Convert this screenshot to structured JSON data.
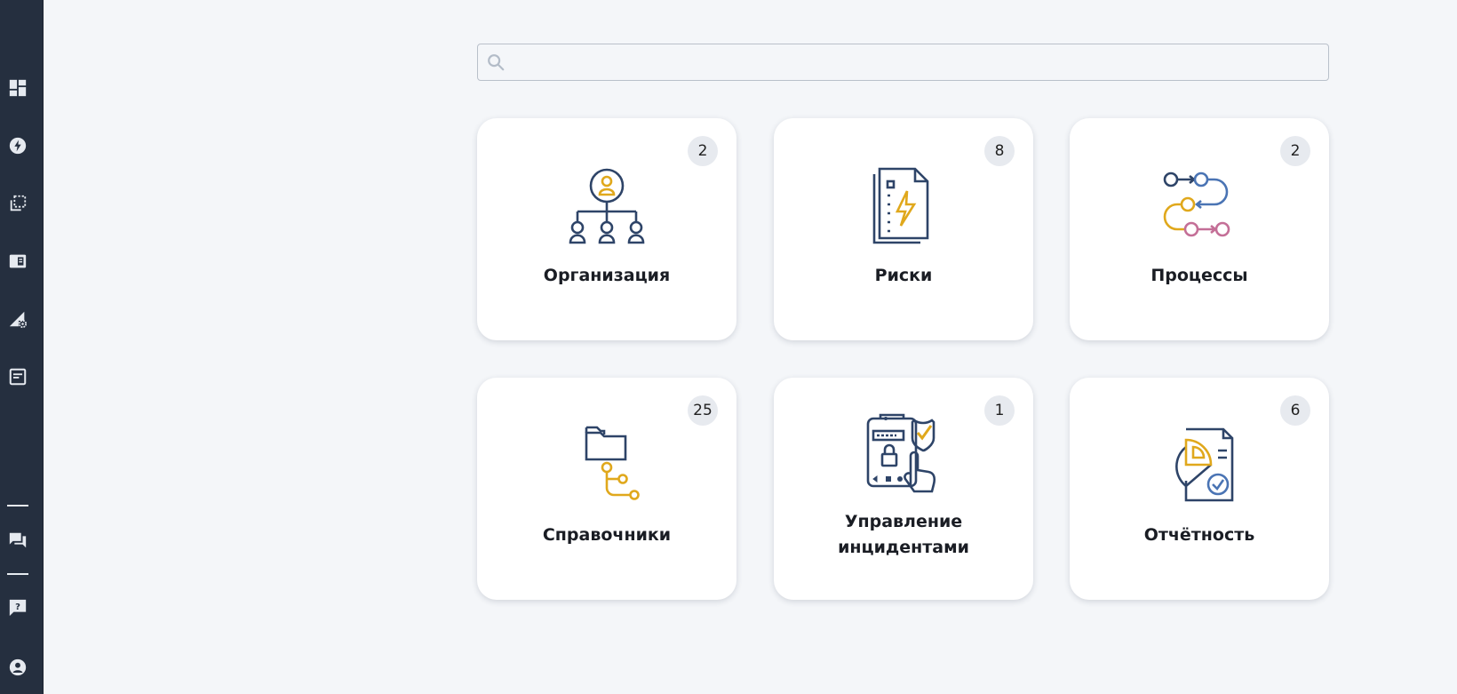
{
  "sidebar": {
    "top_items": [
      {
        "icon": "dashboard-icon"
      },
      {
        "icon": "lightning-icon"
      },
      {
        "icon": "copy-icon"
      },
      {
        "icon": "book-icon"
      },
      {
        "icon": "triangle-gear-icon"
      },
      {
        "icon": "document-icon"
      }
    ],
    "bottom_items": [
      {
        "icon": "chat-icon"
      },
      {
        "icon": "help-icon"
      },
      {
        "icon": "user-icon"
      }
    ]
  },
  "search": {
    "value": "",
    "placeholder": "",
    "icon": "search-icon"
  },
  "cards": [
    {
      "title": "Организация",
      "count": "2",
      "icon": "organization-icon"
    },
    {
      "title": "Риски",
      "count": "8",
      "icon": "risk-document-icon"
    },
    {
      "title": "Процессы",
      "count": "2",
      "icon": "process-flow-icon"
    },
    {
      "title": "Справочники",
      "count": "25",
      "icon": "folder-tree-icon"
    },
    {
      "title_line1": "Управление",
      "title_line2": "инцидентами",
      "count": "1",
      "icon": "incident-security-icon"
    },
    {
      "title": "Отчётность",
      "count": "6",
      "icon": "report-chart-icon"
    }
  ],
  "colors": {
    "sidebar": "#252f3f",
    "background": "#f4f6f9",
    "icon_navy": "#2e4468",
    "icon_yellow": "#e0a81c",
    "icon_blue": "#4a74b4",
    "icon_pink": "#c46f97"
  }
}
